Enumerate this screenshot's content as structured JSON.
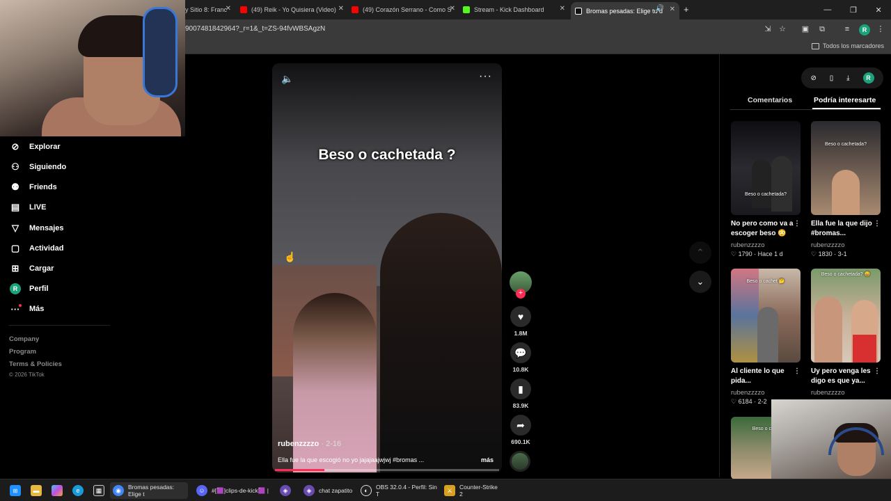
{
  "browser": {
    "tabs": [
      {
        "label": "y Sitio 8: Franc",
        "favicon_color": "#888888"
      },
      {
        "label": "(49) Reik - Yo Quisiera (Video)",
        "favicon_color": "#ff0000"
      },
      {
        "label": "(49) Corazón Serrano - Como S",
        "favicon_color": "#ff0000"
      },
      {
        "label": "Stream - Kick Dashboard",
        "favicon_color": "#53fc18"
      },
      {
        "label": "Bromas pesadas: Elige tu d",
        "favicon_color": "#ffffff"
      }
    ],
    "url": "9007481842964?_r=1&_t=ZS-94fvWBSAgzN",
    "bookmarks_all": "Todos los marcadores",
    "profile_initial": "R"
  },
  "sidebar": {
    "items": [
      {
        "label": "Explorar",
        "icon": "compass-icon"
      },
      {
        "label": "Siguiendo",
        "icon": "following-icon"
      },
      {
        "label": "Friends",
        "icon": "friends-icon"
      },
      {
        "label": "LIVE",
        "icon": "live-icon"
      },
      {
        "label": "Mensajes",
        "icon": "messages-icon"
      },
      {
        "label": "Actividad",
        "icon": "activity-icon"
      },
      {
        "label": "Cargar",
        "icon": "upload-icon"
      },
      {
        "label": "Perfil",
        "icon": "profile-avatar"
      },
      {
        "label": "Más",
        "icon": "more-icon"
      }
    ],
    "profile_initial": "R",
    "footer": [
      "Company",
      "Program",
      "Terms & Policies"
    ],
    "copyright": "© 2026 TikTok"
  },
  "video": {
    "overlay_text": "Beso o cachetada ?",
    "username": "rubenzzzzo",
    "date": "2-16",
    "description": "Ella fue la que escogió no yo jajajaajwjwj #bromas ...",
    "more_label": "más",
    "progress": 0.22
  },
  "actions": {
    "likes": "1.8M",
    "comments": "10.8K",
    "saves": "83.9K",
    "shares": "690.1K"
  },
  "right_panel": {
    "tab_comments": "Comentarios",
    "tab_interest": "Podría interesarte",
    "profile_initial": "R",
    "cards": [
      {
        "caption": "Beso o cachetada?",
        "title": "No pero como va a escoger beso 😳 ...",
        "user": "rubenzzzzo",
        "likes": "1790",
        "meta": "Hace 1 d"
      },
      {
        "caption": "Beso o cachetada?",
        "title": "Ella fue la que dijo #bromas...",
        "user": "rubenzzzzo",
        "likes": "1830",
        "meta": "3-1"
      },
      {
        "caption": "Beso o cachet 🤔",
        "title": "Al cliente lo que pida...",
        "user": "rubenzzzzo",
        "likes": "6184",
        "meta": "2-2"
      },
      {
        "caption": "Beso o cachetada? 😄",
        "title": "Uy pero venga les digo es que ya...",
        "user": "rubenzzzzo",
        "likes": "",
        "meta": ""
      },
      {
        "caption": "Beso o cach",
        "title": "",
        "user": "",
        "likes": "",
        "meta": ""
      }
    ]
  },
  "taskbar": {
    "apps": [
      {
        "label": "Bromas pesadas: Elige t",
        "color": "#4285f4"
      },
      {
        "label": "#[🟪]clips-de-kick🟪 |",
        "color": "#5865f2"
      },
      {
        "label": "",
        "color": "#6a4cb0"
      },
      {
        "label": "chat zapatito",
        "color": "#6a4cb0"
      },
      {
        "label": "OBS 32.0.4 - Perfil: Sin T",
        "color": "#333333"
      },
      {
        "label": "Counter-Strike 2",
        "color": "#d8a020"
      }
    ]
  }
}
